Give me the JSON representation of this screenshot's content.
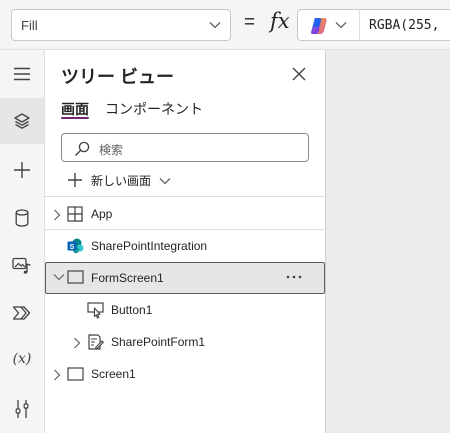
{
  "formula_bar": {
    "property_value": "Fill",
    "equals": "=",
    "fx": "fx",
    "formula_text": "RGBA(255,"
  },
  "rail": {
    "items": [
      "menu-icon",
      "layers-icon",
      "add-icon",
      "data-icon",
      "media-icon",
      "power-automate-icon",
      "variables-icon",
      "tools-icon"
    ],
    "variables_label": "(x)"
  },
  "panel": {
    "title": "ツリー ビュー",
    "tabs": [
      {
        "label": "画面",
        "active": true
      },
      {
        "label": "コンポーネント",
        "active": false
      }
    ],
    "search_placeholder": "検索",
    "new_screen_label": "新しい画面"
  },
  "tree": [
    {
      "label": "App",
      "icon": "app-icon",
      "expandable": true,
      "expanded": false,
      "level": 0
    },
    {
      "label": "SharePointIntegration",
      "icon": "sharepoint-icon",
      "expandable": false,
      "level": 0
    },
    {
      "label": "FormScreen1",
      "icon": "screen-icon",
      "expandable": true,
      "expanded": true,
      "selected": true,
      "level": 0
    },
    {
      "label": "Button1",
      "icon": "button-icon",
      "expandable": false,
      "level": 1
    },
    {
      "label": "SharePointForm1",
      "icon": "form-icon",
      "expandable": true,
      "expanded": false,
      "level": 1
    },
    {
      "label": "Screen1",
      "icon": "screen-icon",
      "expandable": true,
      "expanded": false,
      "level": 0
    }
  ],
  "colors": {
    "accent": "#742774",
    "selected_row_bg": "#e6e6e6",
    "sharepoint_blue": "#0364b8",
    "canvas_bg": "#ebebeb"
  }
}
